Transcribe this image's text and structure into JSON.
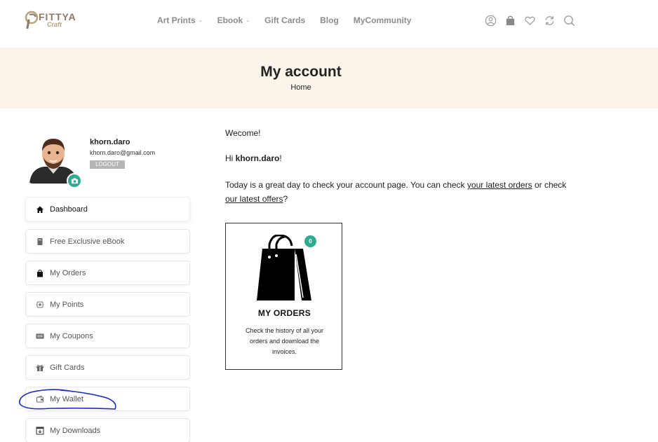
{
  "brand": {
    "name": "FITTYA",
    "sub": "Craft"
  },
  "nav": {
    "items": [
      {
        "label": "Art Prints",
        "dropdown": true
      },
      {
        "label": "Ebook",
        "dropdown": true
      },
      {
        "label": "Gift Cards",
        "dropdown": false
      },
      {
        "label": "Blog",
        "dropdown": false
      },
      {
        "label": "MyCommunity",
        "dropdown": false
      }
    ]
  },
  "header_icons": [
    "user-icon",
    "shopping-bag-icon",
    "heart-icon",
    "refresh-icon",
    "search-icon"
  ],
  "banner": {
    "title": "My account",
    "breadcrumb": "Home"
  },
  "profile": {
    "username": "khorn.daro",
    "email": "khorn.daro@gmail.com",
    "logout_label": "LOGOUT"
  },
  "menu": {
    "items": [
      {
        "label": "Dashboard",
        "icon": "home-icon",
        "active": true
      },
      {
        "label": "Free Exclusive eBook",
        "icon": "book-icon",
        "active": false
      },
      {
        "label": "My Orders",
        "icon": "bag-icon",
        "active": false
      },
      {
        "label": "My Points",
        "icon": "points-icon",
        "active": false
      },
      {
        "label": "My Coupons",
        "icon": "coupon-icon",
        "active": false
      },
      {
        "label": "Gift Cards",
        "icon": "gift-icon",
        "active": false
      },
      {
        "label": "My Wallet",
        "icon": "wallet-icon",
        "active": false
      },
      {
        "label": "My Downloads",
        "icon": "download-icon",
        "active": false
      }
    ]
  },
  "main": {
    "welcome": "Wecome!",
    "hi_prefix": "Hi ",
    "hi_name": "khorn.daro",
    "hi_suffix": "!",
    "para_part1": "Today is a great day to check your account page. You can check ",
    "link_orders": "your latest orders",
    "para_part2": " or check ",
    "link_offers": "our latest offers",
    "para_part3": "?"
  },
  "orders_card": {
    "count": "0",
    "title": "MY ORDERS",
    "description": "Check the history of all your orders and download the invoices."
  },
  "colors": {
    "accent": "#2eab8e",
    "banner_bg": "#fbf4ea",
    "annotation": "#1a2db8"
  }
}
